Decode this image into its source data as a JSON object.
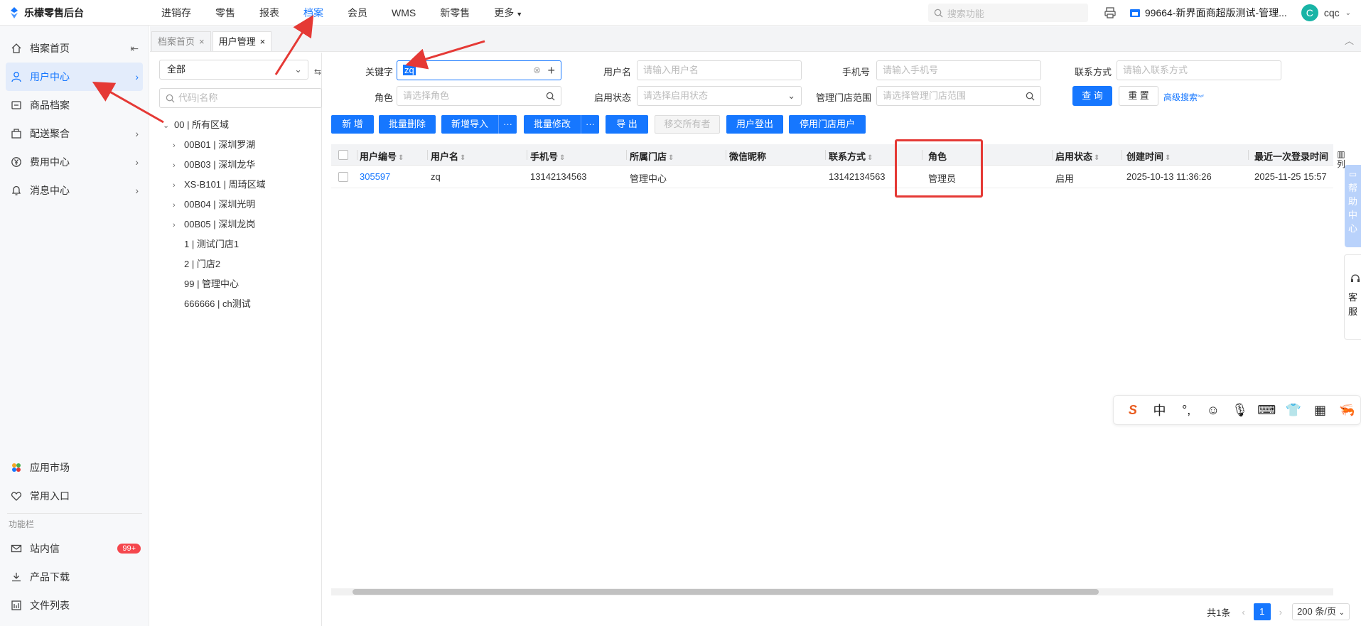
{
  "app": {
    "title": "乐檬零售后台"
  },
  "nav": {
    "items": [
      "进销存",
      "零售",
      "报表",
      "档案",
      "会员",
      "WMS",
      "新零售",
      "更多"
    ],
    "active": "档案"
  },
  "topbar": {
    "search_placeholder": "搜索功能",
    "store": "99664-新界面商超版测试-管理...",
    "user_initial": "C",
    "user_name": "cqc"
  },
  "sidebar": {
    "items": [
      {
        "label": "档案首页",
        "icon": "home-icon"
      },
      {
        "label": "用户中心",
        "icon": "user-icon"
      },
      {
        "label": "商品档案",
        "icon": "goods-icon"
      },
      {
        "label": "配送聚合",
        "icon": "delivery-icon"
      },
      {
        "label": "费用中心",
        "icon": "yen-icon"
      },
      {
        "label": "消息中心",
        "icon": "bell-icon"
      }
    ],
    "bottom": [
      {
        "label": "应用市场",
        "icon": "app-market-icon"
      },
      {
        "label": "常用入口",
        "icon": "heart-icon"
      }
    ],
    "section_title": "功能栏",
    "func": [
      {
        "label": "站内信",
        "icon": "mail-icon",
        "badge": "99+"
      },
      {
        "label": "产品下载",
        "icon": "download-icon"
      },
      {
        "label": "文件列表",
        "icon": "file-list-icon"
      }
    ]
  },
  "tabs": [
    {
      "label": "档案首页",
      "close": "×"
    },
    {
      "label": "用户管理",
      "close": "×"
    }
  ],
  "tree": {
    "select_value": "全部",
    "search_placeholder": "代码|名称",
    "root": "00 | 所有区域",
    "children": [
      "00B01 | 深圳罗湖",
      "00B03 | 深圳龙华",
      "XS-B101 | 周琦区域",
      "00B04 | 深圳光明",
      "00B05 | 深圳龙岗"
    ],
    "leaves": [
      "1 | 测试门店1",
      "2 | 门店2",
      "99 | 管理中心",
      "666666 | ch测试"
    ]
  },
  "filters": {
    "keyword_label": "关键字",
    "keyword_value": "zq",
    "username_label": "用户名",
    "username_placeholder": "请输入用户名",
    "phone_label": "手机号",
    "phone_placeholder": "请输入手机号",
    "contact_label": "联系方式",
    "contact_placeholder": "请输入联系方式",
    "role_label": "角色",
    "role_placeholder": "请选择角色",
    "status_label": "启用状态",
    "status_placeholder": "请选择启用状态",
    "store_scope_label": "管理门店范围",
    "store_scope_placeholder": "请选择管理门店范围",
    "query": "查 询",
    "reset": "重 置",
    "advanced": "高级搜索"
  },
  "toolbar": {
    "add": "新 增",
    "batch_delete": "批量删除",
    "import": "新增导入",
    "more": "···",
    "batch_edit": "批量修改",
    "export": "导 出",
    "transfer_owner": "移交所有者",
    "logout_user": "用户登出",
    "disable_store_user": "停用门店用户"
  },
  "table": {
    "columns": [
      "用户编号",
      "用户名",
      "手机号",
      "所属门店",
      "微信昵称",
      "联系方式",
      "角色",
      "启用状态",
      "创建时间",
      "最近一次登录时间"
    ],
    "rows": [
      [
        "305597",
        "zq",
        "13142134563",
        "管理中心",
        "",
        "13142134563",
        "管理员",
        "启用",
        "2025-10-13 11:36:26",
        "2025-11-25 15:57"
      ]
    ]
  },
  "pager": {
    "total": "共1条",
    "page": "1",
    "page_size": "200 条/页"
  },
  "right_widgets": {
    "column_toggle": "列",
    "help": "帮助中心",
    "service": "客服"
  },
  "ime": {
    "items": [
      "S",
      "中",
      "°,",
      "☺",
      "🎙",
      "⌨",
      "👕",
      "▦",
      "🦐"
    ]
  },
  "colors": {
    "accent": "#1677ff",
    "annotation": "#e53935"
  }
}
